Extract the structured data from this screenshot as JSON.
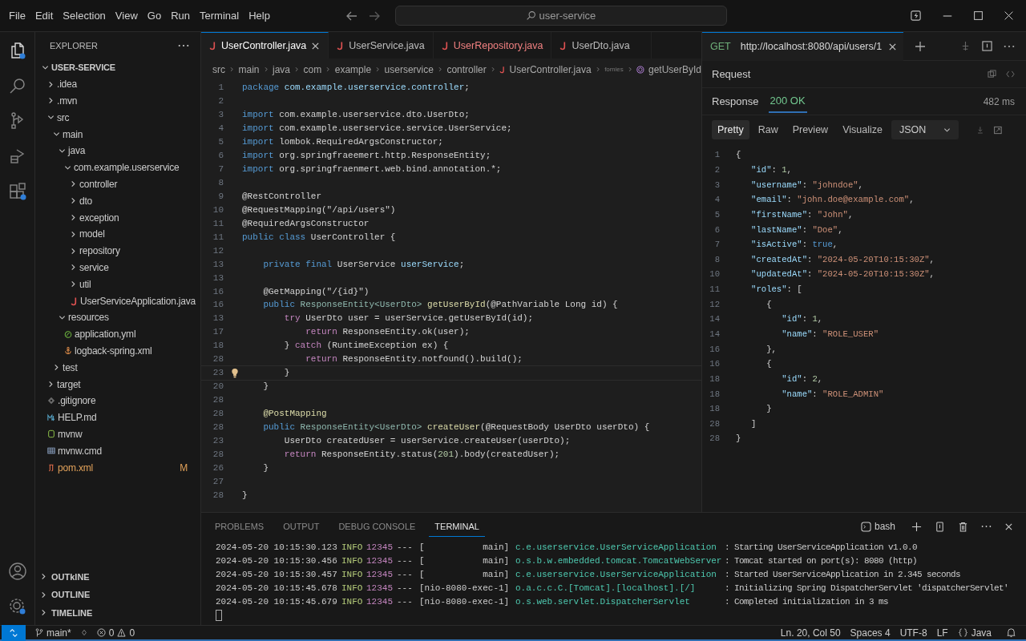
{
  "menu": [
    "File",
    "Edit",
    "Selection",
    "View",
    "Go",
    "Run",
    "Terminal",
    "Help"
  ],
  "command_center": {
    "text": "user-service"
  },
  "activity_bar": {
    "top": [
      {
        "kind": "explorer",
        "selected": true
      },
      {
        "kind": "search",
        "selected": false
      },
      {
        "kind": "source-control",
        "selected": false
      },
      {
        "kind": "run-debug",
        "selected": false
      },
      {
        "kind": "extensions",
        "selected": false
      }
    ],
    "bottom": [
      {
        "kind": "accounts",
        "selected": false
      },
      {
        "kind": "settings",
        "selected": false
      }
    ]
  },
  "sidebar": {
    "title": "EXPLORER",
    "root": {
      "label": "USER-SERVICE",
      "kind": "folder",
      "expanded": true,
      "children": [
        {
          "label": ".idea",
          "kind": "folder",
          "expanded": false
        },
        {
          "label": ".mvn",
          "kind": "folder",
          "expanded": false
        },
        {
          "label": "src",
          "kind": "folder",
          "expanded": true,
          "children": [
            {
              "label": "main",
              "kind": "folder",
              "expanded": true,
              "children": [
                {
                  "label": "java",
                  "kind": "folder",
                  "expanded": true,
                  "children": [
                    {
                      "label": "com.example.userservice",
                      "kind": "folder",
                      "expanded": true,
                      "children": [
                        {
                          "label": "controller",
                          "kind": "folder",
                          "expanded": false
                        },
                        {
                          "label": "dto",
                          "kind": "folder",
                          "expanded": false
                        },
                        {
                          "label": "exception",
                          "kind": "folder",
                          "expanded": false
                        },
                        {
                          "label": "model",
                          "kind": "folder",
                          "expanded": false
                        },
                        {
                          "label": "repository",
                          "kind": "folder",
                          "expanded": false
                        },
                        {
                          "label": "service",
                          "kind": "folder",
                          "expanded": false
                        },
                        {
                          "label": "util",
                          "kind": "folder",
                          "expanded": false
                        },
                        {
                          "label": "UserServiceApplication.java",
                          "kind": "java"
                        }
                      ]
                    }
                  ]
                },
                {
                  "label": "resources",
                  "kind": "folder",
                  "expanded": true,
                  "children": [
                    {
                      "label": "application,yml",
                      "kind": "spring"
                    },
                    {
                      "label": "logback-spring.xml",
                      "kind": "xml"
                    }
                  ]
                }
              ]
            },
            {
              "label": "test",
              "kind": "folder",
              "expanded": false
            }
          ]
        },
        {
          "label": "target",
          "kind": "folder",
          "expanded": false
        },
        {
          "label": ".gitignore",
          "kind": "git"
        },
        {
          "label": "HELP.md",
          "kind": "markdown"
        },
        {
          "label": "mvnw",
          "kind": "shell"
        },
        {
          "label": "mvnw.cmd",
          "kind": "cmd"
        },
        {
          "label": "pom.xml",
          "kind": "maven",
          "badge": "M"
        }
      ]
    },
    "sections": [
      {
        "label": "OUTkINE",
        "expanded": false
      },
      {
        "label": "OUTLINE",
        "expanded": false
      },
      {
        "label": "TIMELINE",
        "expanded": false
      }
    ]
  },
  "editor": {
    "tabs": [
      {
        "label": "UserController.java",
        "selected": true,
        "problem": false
      },
      {
        "label": "UserService.java",
        "selected": false,
        "problem": false
      },
      {
        "label": "UserRepository.java",
        "selected": false,
        "problem": true
      },
      {
        "label": "UserDto.java",
        "selected": false,
        "problem": false
      }
    ],
    "breadcrumb": [
      {
        "label": "src",
        "kind": "folder"
      },
      {
        "label": "main",
        "kind": "folder"
      },
      {
        "label": "java",
        "kind": "folder"
      },
      {
        "label": "com",
        "kind": "folder"
      },
      {
        "label": "example",
        "kind": "folder"
      },
      {
        "label": "userservice",
        "kind": "folder"
      },
      {
        "label": "controller",
        "kind": "folder"
      },
      {
        "label": "UserController.java",
        "kind": "java"
      },
      {
        "label": "fomies",
        "kind": "faded"
      },
      {
        "label": "getUserById",
        "kind": "method"
      }
    ],
    "lines": [
      {
        "num": "1",
        "lightbulb": false,
        "tokens": [
          {
            "text": "package",
            "kind": "keyword"
          },
          {
            "text": " com.example.userservice.controller",
            "kind": "variable"
          },
          {
            "text": ";",
            "kind": "plain"
          }
        ]
      },
      {
        "num": "2",
        "lightbulb": false
      },
      {
        "num": "3",
        "lightbulb": false,
        "tokens": [
          {
            "text": "import",
            "kind": "keyword"
          },
          {
            "text": " com.example.userservice.dto.UserDto;",
            "kind": "plain"
          }
        ]
      },
      {
        "num": "4",
        "lightbulb": false,
        "tokens": [
          {
            "text": "import",
            "kind": "keyword"
          },
          {
            "text": " com.example.userservice.service.UserService;",
            "kind": "plain"
          }
        ]
      },
      {
        "num": "5",
        "lightbulb": false,
        "tokens": [
          {
            "text": "import",
            "kind": "keyword"
          },
          {
            "text": " lombok.RequiredArgsConstructor;",
            "kind": "plain"
          }
        ]
      },
      {
        "num": "6",
        "lightbulb": false,
        "tokens": [
          {
            "text": "import",
            "kind": "keyword"
          },
          {
            "text": " org.springfraeemert.http.ResponseEntity;",
            "kind": "plain"
          }
        ]
      },
      {
        "num": "7",
        "lightbulb": false,
        "tokens": [
          {
            "text": "import",
            "kind": "keyword"
          },
          {
            "text": " org.springfraenmert.web.bind.annotation.*;",
            "kind": "plain"
          }
        ]
      },
      {
        "num": "8",
        "lightbulb": false
      },
      {
        "num": "9",
        "lightbulb": false,
        "tokens": [
          {
            "text": "@RestController",
            "kind": "plain"
          }
        ]
      },
      {
        "num": "10",
        "lightbulb": false,
        "tokens": [
          {
            "text": "@RequestMapping(\"/api/users\")",
            "kind": "plain"
          }
        ]
      },
      {
        "num": "11",
        "lightbulb": false,
        "tokens": [
          {
            "text": "@RequiredArgsConstructor",
            "kind": "plain"
          }
        ]
      },
      {
        "num": "11",
        "lightbulb": false,
        "tokens": [
          {
            "text": "public class",
            "kind": "keyword"
          },
          {
            "text": " UserController {",
            "kind": "plain"
          }
        ]
      },
      {
        "num": "12",
        "lightbulb": false
      },
      {
        "num": "13",
        "lightbulb": false,
        "tokens": [
          {
            "text": "    private final",
            "kind": "keyword"
          },
          {
            "text": " UserService ",
            "kind": "plain"
          },
          {
            "text": "userService",
            "kind": "variable"
          },
          {
            "text": ";",
            "kind": "plain"
          }
        ]
      },
      {
        "num": "13",
        "lightbulb": false
      },
      {
        "num": "16",
        "lightbulb": false,
        "tokens": [
          {
            "text": "    @GetMapping(\"/{id}\")",
            "kind": "plain"
          }
        ]
      },
      {
        "num": "16",
        "lightbulb": false,
        "tokens": [
          {
            "text": "    public",
            "kind": "keyword"
          },
          {
            "text": " ResponseEntity<UserDto>",
            "kind": "type"
          },
          {
            "text": " getUserById",
            "kind": "function"
          },
          {
            "text": "(@PathVariable Long id) {",
            "kind": "plain"
          }
        ]
      },
      {
        "num": "13",
        "lightbulb": false,
        "tokens": [
          {
            "text": "        try",
            "kind": "control"
          },
          {
            "text": " UserDto user = userService.getUserById(id);",
            "kind": "plain"
          }
        ]
      },
      {
        "num": "17",
        "lightbulb": false,
        "tokens": [
          {
            "text": "            return",
            "kind": "control"
          },
          {
            "text": " ResponseEntity.ok(user);",
            "kind": "plain"
          }
        ]
      },
      {
        "num": "18",
        "lightbulb": false,
        "tokens": [
          {
            "text": "        } ",
            "kind": "plain"
          },
          {
            "text": "catch",
            "kind": "control"
          },
          {
            "text": " (RuntimeException ex) {",
            "kind": "plain"
          }
        ]
      },
      {
        "num": "28",
        "lightbulb": false,
        "tokens": [
          {
            "text": "            return",
            "kind": "control"
          },
          {
            "text": " ResponseEntity.notfound().build();",
            "kind": "plain"
          }
        ]
      },
      {
        "num": "23",
        "lightbulb": true,
        "tokens": [
          {
            "text": "        }",
            "kind": "plain"
          }
        ]
      },
      {
        "num": "20",
        "lightbulb": false,
        "tokens": [
          {
            "text": "    }",
            "kind": "plain"
          }
        ]
      },
      {
        "num": "28",
        "lightbulb": false
      },
      {
        "num": "28",
        "lightbulb": false,
        "tokens": [
          {
            "text": "    @PostMapping",
            "kind": "function"
          }
        ]
      },
      {
        "num": "28",
        "lightbulb": false,
        "tokens": [
          {
            "text": "    public",
            "kind": "keyword"
          },
          {
            "text": " ResponseEntity<UserDto>",
            "kind": "type"
          },
          {
            "text": " createUser",
            "kind": "function"
          },
          {
            "text": "(@RequestBody UserDto userDto) {",
            "kind": "plain"
          }
        ]
      },
      {
        "num": "23",
        "lightbulb": false,
        "tokens": [
          {
            "text": "        UserDto createdUser = userService.createUser(userDto);",
            "kind": "plain"
          }
        ]
      },
      {
        "num": "28",
        "lightbulb": false,
        "tokens": [
          {
            "text": "        return",
            "kind": "control"
          },
          {
            "text": " ResponseEntity.status(",
            "kind": "plain"
          },
          {
            "text": "201",
            "kind": "number"
          },
          {
            "text": ").body(createdUser);",
            "kind": "plain"
          }
        ]
      },
      {
        "num": "26",
        "lightbulb": false,
        "tokens": [
          {
            "text": "    }",
            "kind": "plain"
          }
        ]
      },
      {
        "num": "27",
        "lightbulb": false
      },
      {
        "num": "28",
        "lightbulb": false,
        "tokens": [
          {
            "text": "}",
            "kind": "plain"
          }
        ]
      }
    ]
  },
  "request": {
    "method": "GET",
    "url": "http://localhost:8080/api/users/1",
    "section": "Request",
    "response": {
      "label": "Response",
      "status": "200 OK",
      "time": "482 ms"
    },
    "view_tabs": [
      {
        "label": "Pretty",
        "selected": true
      },
      {
        "label": "Raw",
        "selected": false
      },
      {
        "label": "Preview",
        "selected": false
      },
      {
        "label": "Visualize",
        "selected": false
      }
    ],
    "format": "JSON",
    "body": [
      {
        "num": "1",
        "tokens": [
          {
            "text": "{",
            "kind": "plain"
          }
        ]
      },
      {
        "num": "2",
        "tokens": [
          {
            "text": "   \"id\"",
            "kind": "key"
          },
          {
            "text": ": ",
            "kind": "plain"
          },
          {
            "text": "1",
            "kind": "number"
          },
          {
            "text": ",",
            "kind": "plain"
          }
        ]
      },
      {
        "num": "3",
        "tokens": [
          {
            "text": "   \"username\"",
            "kind": "key"
          },
          {
            "text": ": ",
            "kind": "plain"
          },
          {
            "text": "\"johndoe\"",
            "kind": "string"
          },
          {
            "text": ",",
            "kind": "plain"
          }
        ]
      },
      {
        "num": "4",
        "tokens": [
          {
            "text": "   \"email\"",
            "kind": "key"
          },
          {
            "text": ": ",
            "kind": "plain"
          },
          {
            "text": "\"john.doe@example.com\"",
            "kind": "string"
          },
          {
            "text": ",",
            "kind": "plain"
          }
        ]
      },
      {
        "num": "5",
        "tokens": [
          {
            "text": "   \"firstName\"",
            "kind": "key"
          },
          {
            "text": ": ",
            "kind": "plain"
          },
          {
            "text": "\"John\"",
            "kind": "string"
          },
          {
            "text": ",",
            "kind": "plain"
          }
        ]
      },
      {
        "num": "6",
        "tokens": [
          {
            "text": "   \"lastName\"",
            "kind": "key"
          },
          {
            "text": ": ",
            "kind": "plain"
          },
          {
            "text": "\"Doe\"",
            "kind": "string"
          },
          {
            "text": ",",
            "kind": "plain"
          }
        ]
      },
      {
        "num": "7",
        "tokens": [
          {
            "text": "   \"isActive\"",
            "kind": "key"
          },
          {
            "text": ": ",
            "kind": "plain"
          },
          {
            "text": "true",
            "kind": "boolean"
          },
          {
            "text": ",",
            "kind": "plain"
          }
        ]
      },
      {
        "num": "8",
        "tokens": [
          {
            "text": "   \"createdAt\"",
            "kind": "key"
          },
          {
            "text": ": ",
            "kind": "plain"
          },
          {
            "text": "\"2024-05-20T10:15:30Z\"",
            "kind": "string"
          },
          {
            "text": ",",
            "kind": "plain"
          }
        ]
      },
      {
        "num": "10",
        "tokens": [
          {
            "text": "   \"updatedAt\"",
            "kind": "key"
          },
          {
            "text": ": ",
            "kind": "plain"
          },
          {
            "text": "\"2024-05-20T10:15:30Z\"",
            "kind": "string"
          },
          {
            "text": ",",
            "kind": "plain"
          }
        ]
      },
      {
        "num": "11",
        "tokens": [
          {
            "text": "   \"roles\"",
            "kind": "key"
          },
          {
            "text": ": [",
            "kind": "plain"
          }
        ]
      },
      {
        "num": "12",
        "tokens": [
          {
            "text": "      {",
            "kind": "plain"
          }
        ]
      },
      {
        "num": "14",
        "tokens": [
          {
            "text": "         \"id\"",
            "kind": "key"
          },
          {
            "text": ": ",
            "kind": "plain"
          },
          {
            "text": "1",
            "kind": "number"
          },
          {
            "text": ",",
            "kind": "plain"
          }
        ]
      },
      {
        "num": "14",
        "tokens": [
          {
            "text": "         \"name\"",
            "kind": "key"
          },
          {
            "text": ": ",
            "kind": "plain"
          },
          {
            "text": "\"ROLE_USER\"",
            "kind": "string"
          }
        ]
      },
      {
        "num": "16",
        "tokens": [
          {
            "text": "      },",
            "kind": "plain"
          }
        ]
      },
      {
        "num": "16",
        "tokens": [
          {
            "text": "      {",
            "kind": "plain"
          }
        ]
      },
      {
        "num": "18",
        "tokens": [
          {
            "text": "         \"id\"",
            "kind": "key"
          },
          {
            "text": ": ",
            "kind": "plain"
          },
          {
            "text": "2",
            "kind": "number"
          },
          {
            "text": ",",
            "kind": "plain"
          }
        ]
      },
      {
        "num": "18",
        "tokens": [
          {
            "text": "         \"name\"",
            "kind": "key"
          },
          {
            "text": ": ",
            "kind": "plain"
          },
          {
            "text": "\"ROLE_ADMIN\"",
            "kind": "string"
          }
        ]
      },
      {
        "num": "18",
        "tokens": [
          {
            "text": "      }",
            "kind": "plain"
          }
        ]
      },
      {
        "num": "28",
        "tokens": [
          {
            "text": "   ]",
            "kind": "plain"
          }
        ]
      },
      {
        "num": "28",
        "tokens": [
          {
            "text": "}",
            "kind": "plain"
          }
        ]
      }
    ]
  },
  "panel": {
    "tabs": [
      {
        "label": "PROBLEMS",
        "selected": false
      },
      {
        "label": "OUTPUT",
        "selected": false
      },
      {
        "label": "DEBUG CONSOLE",
        "selected": false
      },
      {
        "label": "TERMINAL",
        "selected": true
      }
    ],
    "shell": "bash",
    "lines": [
      {
        "time": "2024-05-20 10:15:30.123",
        "level": "INFO",
        "pid": "12345",
        "sep": "---",
        "thread": "[           main]",
        "logger": "c.e.userservice.UserServiceApplication",
        "message": ": Starting UserServiceApplication v1.0.0"
      },
      {
        "time": "2024-05-20 10:15:30.456",
        "level": "INFO",
        "pid": "12345",
        "sep": "---",
        "thread": "[           main]",
        "logger": "o.s.b.w.embedded.tomcat.TomcatWebServer",
        "message": ": Tomcat started on port(s): 8080 (http)"
      },
      {
        "time": "2024-05-20 10:15:30.457",
        "level": "INFO",
        "pid": "12345",
        "sep": "---",
        "thread": "[           main]",
        "logger": "c.e.userservice.UserServiceApplication",
        "message": ": Started UserServiceApplication in 2.345 seconds"
      },
      {
        "time": "2024-05-20 10:15:45.678",
        "level": "INFO",
        "pid": "12345",
        "sep": "---",
        "thread": "[nio-8080-exec-1]",
        "logger": "o.a.c.c.C.[Tomcat].[localhost].[/]",
        "message": ": Initializing Spring DispatcherServlet 'dispatcherServlet'"
      },
      {
        "time": "2024-05-20 10:15:45.679",
        "level": "INFO",
        "pid": "12345",
        "sep": "---",
        "thread": "[nio-8080-exec-1]",
        "logger": "o.s.web.servlet.DispatcherServlet",
        "message": ": Completed initialization in 3 ms"
      }
    ]
  },
  "status_bar": {
    "branch": "main*",
    "errors": "0",
    "warnings": "0",
    "items": [
      "Ln. 20, Col 50",
      "Spaces 4",
      "UTF-8",
      "LF"
    ],
    "language": "Java"
  }
}
